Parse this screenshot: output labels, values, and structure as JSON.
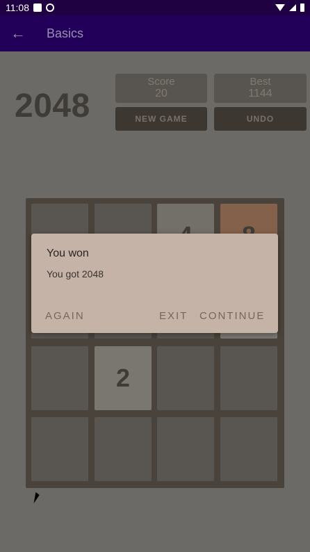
{
  "status_bar": {
    "time": "11:08"
  },
  "app_bar": {
    "title": "Basics",
    "back_icon": "arrow-back-icon"
  },
  "game": {
    "logo": "2048",
    "score_label": "Score",
    "score_value": "20",
    "best_label": "Best",
    "best_value": "1144",
    "new_game_label": "NEW GAME",
    "undo_label": "UNDO"
  },
  "board": {
    "visible_tiles": [
      {
        "row": 0,
        "col": 2,
        "value": "4"
      },
      {
        "row": 0,
        "col": 3,
        "value": "8"
      },
      {
        "row": 2,
        "col": 1,
        "value": "2"
      }
    ]
  },
  "dialog": {
    "title": "You won",
    "message": "You got 2048",
    "again_label": "AGAIN",
    "exit_label": "EXIT",
    "continue_label": "CONTINUE"
  },
  "colors": {
    "app_bar": "#22005a",
    "status_bar": "#1f0040",
    "board": "#4a433b",
    "dialog": "#c4b3a6",
    "dialog_button_text": "#7a6656"
  }
}
